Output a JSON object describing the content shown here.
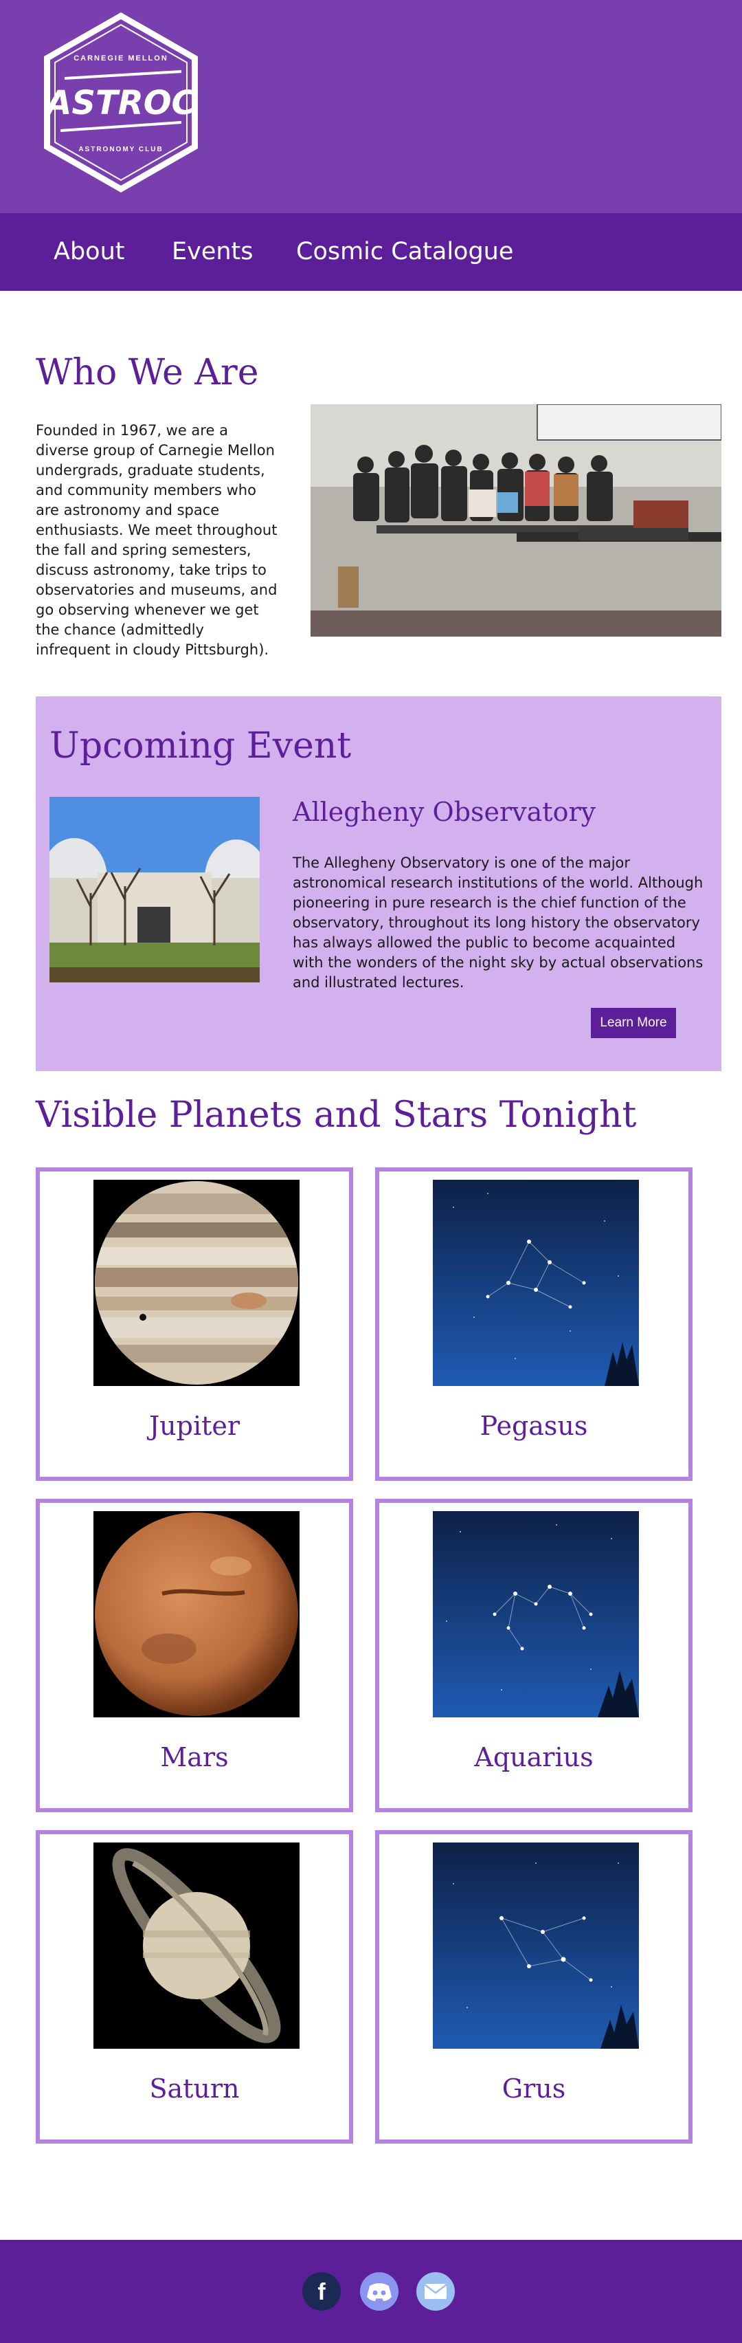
{
  "logo": {
    "line_top": "CARNEGIE MELLON",
    "name": "ASTROC",
    "line_bottom": "ASTRONOMY CLUB"
  },
  "nav": {
    "items": [
      "About",
      "Events",
      "Cosmic Catalogue"
    ]
  },
  "who": {
    "title": "Who We Are",
    "text": "Founded in 1967, we are a diverse group of Carnegie Mellon undergrads, graduate students, and community members who are astronomy and space enthusiasts. We meet throughout the fall and spring semesters, discuss astronomy, take trips to observatories and museums, and go observing whenever we get the chance (admittedly infrequent in cloudy Pittsburgh)."
  },
  "event": {
    "title": "Upcoming Event",
    "name": "Allegheny Observatory",
    "description": "The Allegheny Observatory is one of the major astronomical research institutions of the world. Although pioneering in pure research is the chief function of the observatory, throughout its long history the observatory has always allowed the public to become acquainted with the wonders of the night sky by actual observations and illustrated lectures.",
    "button": "Learn More"
  },
  "sky": {
    "title": "Visible Planets and Stars Tonight",
    "cards": [
      "Jupiter",
      "Pegasus",
      "Mars",
      "Aquarius",
      "Saturn",
      "Grus"
    ]
  },
  "footer": {
    "icons": [
      "facebook-icon",
      "discord-icon",
      "mail-icon"
    ]
  },
  "colors": {
    "header": "#7a3fae",
    "nav": "#5d1f99",
    "accent": "#5d1f99",
    "event_bg": "#d2b1ee",
    "card_border": "#b482e0"
  }
}
